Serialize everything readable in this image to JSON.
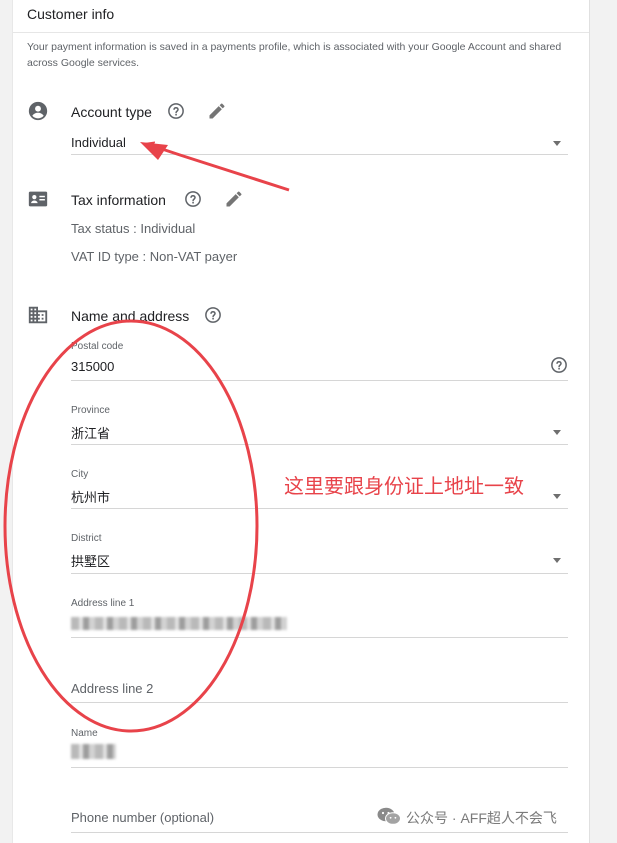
{
  "card": {
    "title": "Customer info",
    "notice": "Your payment information is saved in a payments profile, which is associated with your Google Account and shared across Google services."
  },
  "account_type": {
    "title": "Account type",
    "value": "Individual"
  },
  "tax": {
    "title": "Tax information",
    "status": "Tax status : Individual",
    "vat": "VAT ID type : Non-VAT payer"
  },
  "address": {
    "title": "Name and address",
    "postal_label": "Postal code",
    "postal_value": "315000",
    "province_label": "Province",
    "province_value": "浙江省",
    "city_label": "City",
    "city_value": "杭州市",
    "district_label": "District",
    "district_value": "拱墅区",
    "line1_label": "Address line 1",
    "line2_placeholder": "Address line 2",
    "name_label": "Name",
    "phone_placeholder": "Phone number (optional)"
  },
  "annotation": {
    "text": "这里要跟身份证上地址一致",
    "color": "#e8434a"
  },
  "watermark": {
    "text": "公众号 · AFF超人不会飞"
  },
  "icons": {
    "account": "account-circle-icon",
    "tax": "badge-icon",
    "address": "building-icon",
    "help": "help-circle-icon",
    "edit": "pencil-icon",
    "dropdown": "arrow-drop-down-icon"
  }
}
